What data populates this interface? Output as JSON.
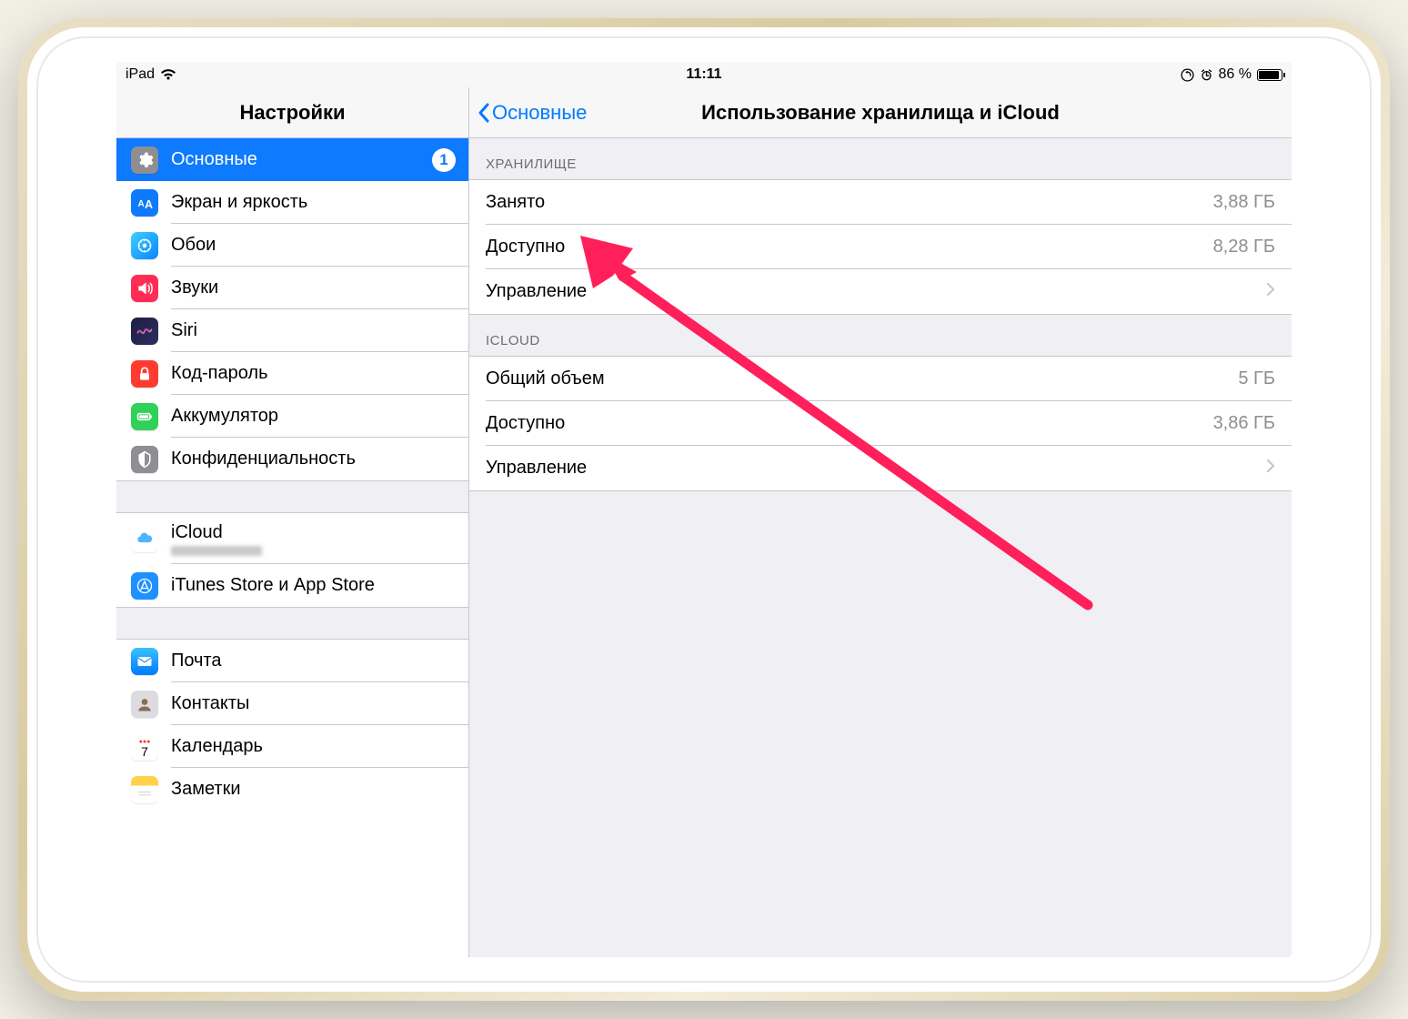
{
  "status": {
    "device": "iPad",
    "time": "11:11",
    "battery_text": "86 %",
    "battery_pct": 86
  },
  "nav": {
    "left_title": "Настройки",
    "back_label": "Основные",
    "right_title": "Использование хранилища и iCloud"
  },
  "sidebar": {
    "groups": [
      [
        {
          "id": "general",
          "label": "Основные",
          "icon": "gear-icon",
          "selected": true,
          "badge": "1"
        },
        {
          "id": "display",
          "label": "Экран и яркость",
          "icon": "display-icon"
        },
        {
          "id": "wallpaper",
          "label": "Обои",
          "icon": "wallpaper-icon"
        },
        {
          "id": "sounds",
          "label": "Звуки",
          "icon": "sound-icon"
        },
        {
          "id": "siri",
          "label": "Siri",
          "icon": "siri-icon"
        },
        {
          "id": "passcode",
          "label": "Код-пароль",
          "icon": "lock-icon"
        },
        {
          "id": "battery",
          "label": "Аккумулятор",
          "icon": "battery-icon"
        },
        {
          "id": "privacy",
          "label": "Конфиденциальность",
          "icon": "privacy-icon"
        }
      ],
      [
        {
          "id": "icloud",
          "label": "iCloud",
          "icon": "icloud-icon",
          "sub_blurred": true
        },
        {
          "id": "stores",
          "label": "iTunes Store и App Store",
          "icon": "appstore-icon"
        }
      ],
      [
        {
          "id": "mail",
          "label": "Почта",
          "icon": "mail-icon"
        },
        {
          "id": "contacts",
          "label": "Контакты",
          "icon": "contacts-icon"
        },
        {
          "id": "calendar",
          "label": "Календарь",
          "icon": "calendar-icon"
        },
        {
          "id": "notes",
          "label": "Заметки",
          "icon": "notes-icon"
        }
      ]
    ]
  },
  "detail": {
    "sections": [
      {
        "header": "ХРАНИЛИЩЕ",
        "rows": [
          {
            "key": "Занято",
            "val": "3,88 ГБ",
            "chevron": false,
            "interactable": false
          },
          {
            "key": "Доступно",
            "val": "8,28 ГБ",
            "chevron": false,
            "interactable": false
          },
          {
            "key": "Управление",
            "val": "",
            "chevron": true,
            "interactable": true,
            "highlighted": true
          }
        ]
      },
      {
        "header": "ICLOUD",
        "rows": [
          {
            "key": "Общий объем",
            "val": "5 ГБ",
            "chevron": false,
            "interactable": false
          },
          {
            "key": "Доступно",
            "val": "3,86 ГБ",
            "chevron": false,
            "interactable": false
          },
          {
            "key": "Управление",
            "val": "",
            "chevron": true,
            "interactable": true
          }
        ]
      }
    ]
  },
  "arrow_color": "#ff1f5a"
}
